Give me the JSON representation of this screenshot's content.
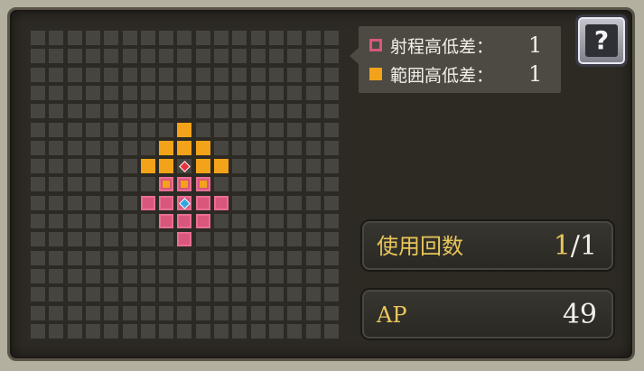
{
  "colors": {
    "range": "#f2a31a",
    "target": "#d9577a",
    "origin_marker": "#2fa8e0",
    "center_marker": "#e8323c"
  },
  "grid": {
    "columns": 17,
    "rows": 17,
    "range_cells": [
      [
        8,
        5
      ],
      [
        7,
        6
      ],
      [
        8,
        6
      ],
      [
        9,
        6
      ],
      [
        6,
        7
      ],
      [
        7,
        7
      ],
      [
        9,
        7
      ],
      [
        10,
        7
      ]
    ],
    "target_cells": [
      [
        7,
        8
      ],
      [
        8,
        8
      ],
      [
        9,
        8
      ],
      [
        6,
        9
      ],
      [
        7,
        9
      ],
      [
        8,
        9
      ],
      [
        9,
        9
      ],
      [
        10,
        9
      ],
      [
        7,
        10
      ],
      [
        8,
        10
      ],
      [
        9,
        10
      ],
      [
        8,
        11
      ]
    ],
    "target_inner_range_cells": [
      [
        7,
        8
      ],
      [
        8,
        8
      ],
      [
        9,
        8
      ]
    ],
    "center_cell": [
      8,
      7
    ],
    "origin_cell": [
      8,
      9
    ]
  },
  "legend": {
    "range_height_label": "射程高低差：",
    "range_height_value": "1",
    "area_height_label": "範囲高低差：",
    "area_height_value": "1"
  },
  "help_button": {
    "icon": "question-book-icon",
    "glyph": "?"
  },
  "uses": {
    "label": "使用回数",
    "current": "1",
    "max": "/1"
  },
  "ap": {
    "label": "AP",
    "value": "49"
  }
}
